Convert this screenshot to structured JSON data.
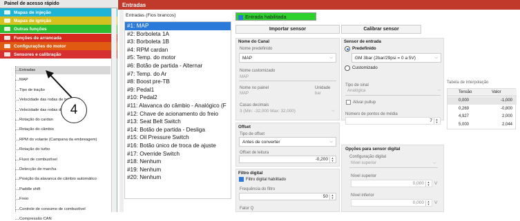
{
  "left_panel": {
    "title": "Painel de acesso rápido",
    "categories": [
      {
        "label": "Mapas de injeção",
        "color": "#1fb3d6"
      },
      {
        "label": "Mapas de ignição",
        "color": "#d6c21f"
      },
      {
        "label": "Outras funções",
        "color": "#2ebd2e"
      },
      {
        "label": "Funções de arrancada",
        "color": "#d62a1f"
      },
      {
        "label": "Configurações do motor",
        "color": "#e05a12"
      },
      {
        "label": "Sensores e calibração",
        "color": "#d63030"
      }
    ],
    "items": [
      "Entradas",
      "MAP",
      "Tipo de tração",
      "Velocidade das rodas de tração",
      "Velocidade das rodas de ...",
      "Rotação do cardan",
      "Rotação do câmbio",
      "RPM do volante (Campana da embreagem)",
      "Rotação do turbo",
      "Fluxo de combustível",
      "Detecção de marcha",
      "Posição da alavanca de câmbio automático",
      "Paddle shift",
      "Freio",
      "Controle de consumo de combustível",
      "Compressão CAN"
    ],
    "callout_number": "4"
  },
  "header": {
    "title": "Entradas"
  },
  "inputs_list": {
    "header": "Entradas (Fios brancos)",
    "items": [
      "#1: MAP",
      "#2: Borboleta 1A",
      "#3: Borboleta 1B",
      "#4: RPM cardan",
      "#5: Temp. do motor",
      "#6: Botão de partida - Alternar",
      "#7: Temp. do Ar",
      "#8: Boost pre-TB",
      "#9: Pedal1",
      "#10: Pedal2",
      "#11: Alavanca do câmbio - Analógico (F",
      "#12: Chave de acionamento do freio",
      "#13: Seat Belt Switch",
      "#14: Botão de partida - Desliga",
      "#15: Oil Pressure Switch",
      "#16: Botão único de troca de ajuste",
      "#17: Override Switch",
      "#18: Nenhum",
      "#19: Nenhum",
      "#20: Nenhum"
    ]
  },
  "toolbar": {
    "enabled_label": "Entrada habilitada",
    "import_label": "Importar sensor",
    "calibrate_label": "Calibrar sensor"
  },
  "channel": {
    "title": "Nome do Canal",
    "predef_label": "Nome predefinido",
    "predef_value": "MAP",
    "custom_label": "Nome customizado",
    "custom_value": "MAP",
    "panel_label": "Nome no painel",
    "panel_value": "MAP",
    "unit_label": "Unidade",
    "unit_value": "bar",
    "decimals_label": "Casas decimais",
    "decimals_value": "3 (Min: -32,000 Max: 32,000)"
  },
  "offset": {
    "title": "Offset",
    "type_label": "Tipo de offset",
    "type_value": "Antes de converter",
    "read_label": "Offset de leitura",
    "read_value": "-0,200"
  },
  "filter": {
    "title": "Filtro digital",
    "enabled_label": "Filtro digital habilitado",
    "freq_label": "Frequência do filtro",
    "freq_value": "50",
    "factor_label": "Fator Q"
  },
  "sensor_input": {
    "title": "Sensor de entrada",
    "predef_label": "Predefinido",
    "predef_value": "GM 3bar (2bar/29psi = 0 a 5V)",
    "custom_label": "Customizado",
    "signal_label": "Tipo de sinal",
    "signal_value": "Analógica",
    "pullup_label": "Ativar pullup",
    "points_label": "Número de pontos de média",
    "points_value": "7"
  },
  "digital_options": {
    "title": "Opções para sensor digital",
    "config_label": "Configuração digital",
    "config_value": "Nível superior",
    "upper_label": "Nível superior",
    "upper_value": "0,000",
    "upper_unit": "V",
    "lower_label": "Nível inferior",
    "lower_value": "0,000",
    "lower_unit": "V"
  },
  "interp_table": {
    "label": "Tabela de interpolação",
    "headers": [
      "Tensão",
      "Valor"
    ],
    "rows": [
      [
        "0,000",
        "-1,000"
      ],
      [
        "0,269",
        "-0,800"
      ],
      [
        "4,927",
        "2,000"
      ],
      [
        "5,000",
        "2,044"
      ]
    ]
  }
}
